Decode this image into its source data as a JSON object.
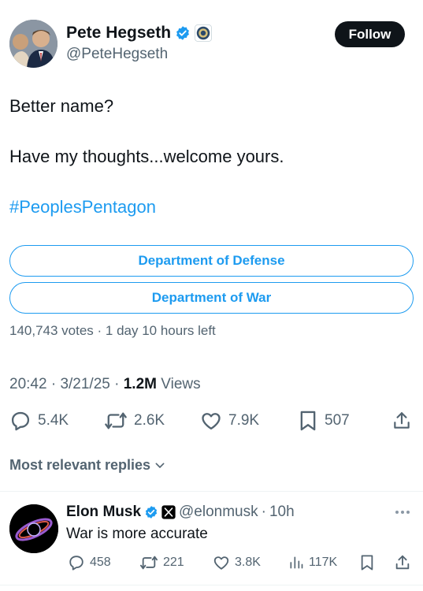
{
  "tweet": {
    "author_name": "Pete Hegseth",
    "author_handle": "@PeteHegseth",
    "follow_label": "Follow",
    "line1": "Better name?",
    "line2": "Have my thoughts...welcome yours.",
    "hashtag": "#PeoplesPentagon",
    "poll": {
      "options": [
        "Department of Defense",
        "Department of War"
      ],
      "meta": "140,743 votes · 1 day 10 hours left"
    },
    "time": "20:42",
    "date": "3/21/25",
    "views_count": "1.2M",
    "views_label": "Views",
    "stats": {
      "replies": "5.4K",
      "reposts": "2.6K",
      "likes": "7.9K",
      "bookmarks": "507"
    }
  },
  "replies_filter": "Most relevant replies",
  "reply": {
    "author_name": "Elon Musk",
    "author_handle": "@elonmusk",
    "time": "10h",
    "text": "War is more accurate",
    "stats": {
      "replies": "458",
      "reposts": "221",
      "likes": "3.8K",
      "views": "117K"
    }
  },
  "colors": {
    "accent": "#1d9bf0",
    "text": "#0f1419",
    "muted": "#536471",
    "verified": "#1d9bf0"
  }
}
